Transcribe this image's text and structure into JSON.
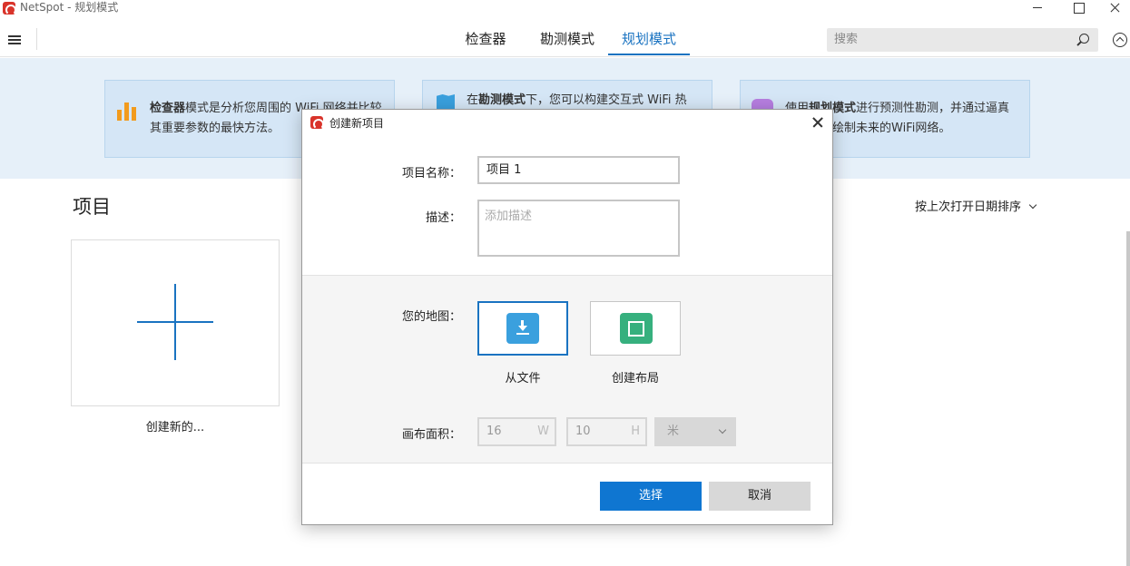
{
  "window": {
    "title": "NetSpot - 规划模式"
  },
  "nav": {
    "tabs": [
      "检查器",
      "勘测模式",
      "规划模式"
    ],
    "active_tab": "规划模式",
    "search_placeholder": "搜索"
  },
  "banner": {
    "cards": [
      {
        "bold": "检查器",
        "text": "模式是分析您周围的 WiFi 网络并比较其重要参数的最快方法。"
      },
      {
        "prefix": "在",
        "bold": "勘测模式",
        "text": "下，您可以构建交互式 WiFi 热"
      },
      {
        "prefix": "使用",
        "bold": "规划模式",
        "text": "进行预测性勘测，并通过逼真信号仿真绘制未来的WiFi网络。"
      }
    ]
  },
  "projects": {
    "title": "项目",
    "sort_label": "按上次打开日期排序",
    "new_label": "创建新的..."
  },
  "dialog": {
    "title": "创建新项目",
    "name_label": "项目名称：",
    "name_value": "项目 1",
    "desc_label": "描述：",
    "desc_placeholder": "添加描述",
    "map_label": "您的地图：",
    "map_options": [
      "从文件",
      "创建布局"
    ],
    "canvas_label": "画布面积：",
    "width_value": "16",
    "width_suffix": "W",
    "height_value": "10",
    "height_suffix": "H",
    "unit": "米",
    "select_button": "选择",
    "cancel_button": "取消"
  },
  "colors": {
    "accent": "#1a73c1",
    "primary_button": "#0f76d1",
    "banner_bg": "#e6f0f9"
  }
}
